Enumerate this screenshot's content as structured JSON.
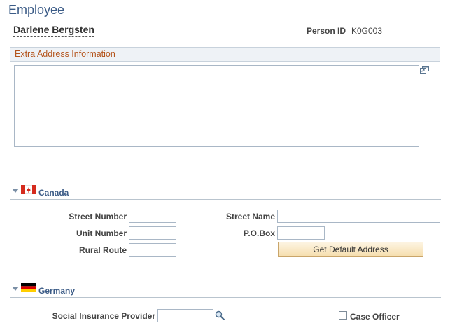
{
  "page": {
    "title": "Employee"
  },
  "employee": {
    "name": "Darlene Bergsten",
    "person_id_label": "Person ID",
    "person_id": "K0G003"
  },
  "extra_address": {
    "title": "Extra Address Information",
    "value": ""
  },
  "canada": {
    "title": "Canada",
    "street_number_label": "Street Number",
    "street_name_label": "Street Name",
    "unit_number_label": "Unit Number",
    "po_box_label": "P.O.Box",
    "rural_route_label": "Rural Route",
    "default_address_button": "Get Default Address",
    "street_number": "",
    "street_name": "",
    "unit_number": "",
    "po_box": "",
    "rural_route": ""
  },
  "germany": {
    "title": "Germany",
    "social_insurance_label": "Social Insurance Provider",
    "social_insurance_value": "",
    "case_officer_label": "Case Officer"
  },
  "icons": {
    "expand": "expand-window-icon",
    "lookup": "magnifier-icon",
    "canada_flag": "canada-flag-icon",
    "germany_flag": "germany-flag-icon"
  },
  "colors": {
    "title": "#3c5c87",
    "group_title": "#b4541c",
    "button_bg": "#f6dfb0"
  }
}
